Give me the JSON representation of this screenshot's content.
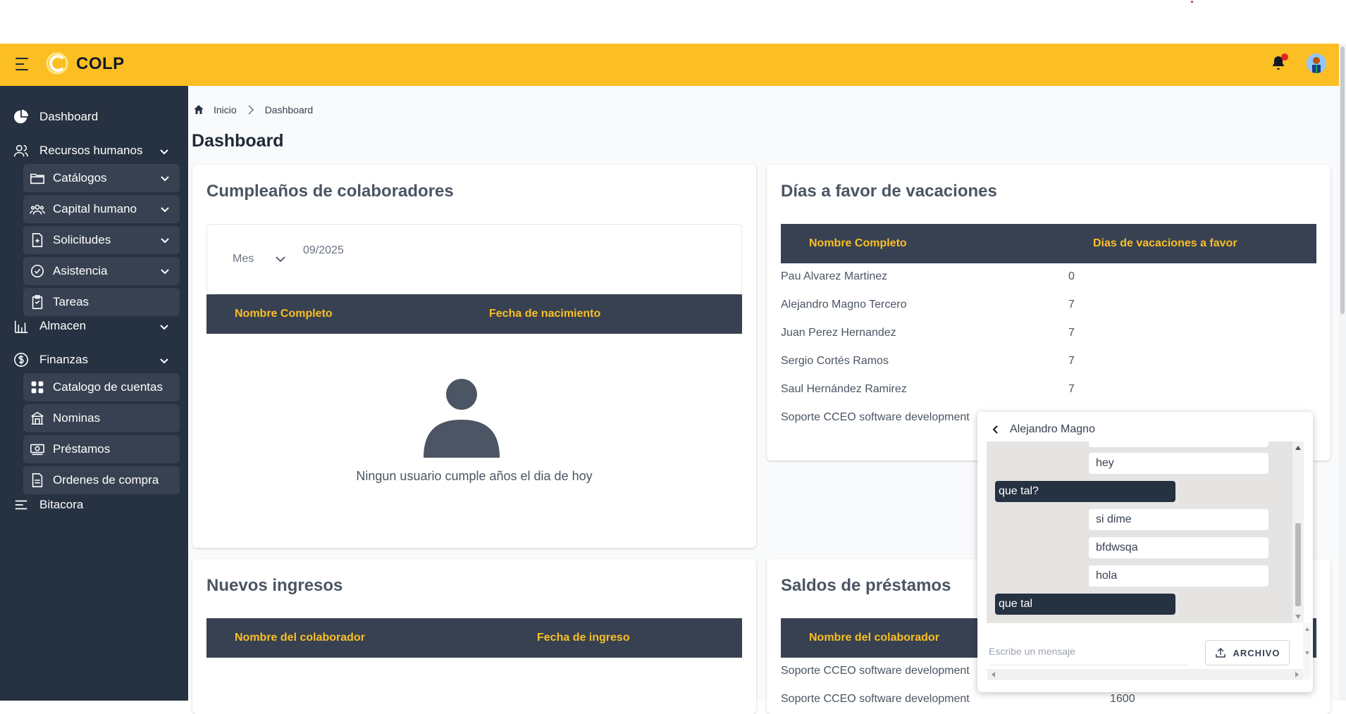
{
  "app": {
    "brand": "COLP"
  },
  "sidebar": {
    "items": [
      {
        "label": "Dashboard"
      },
      {
        "label": "Recursos humanos"
      },
      {
        "label": "Catálogos"
      },
      {
        "label": "Capital humano"
      },
      {
        "label": "Solicitudes"
      },
      {
        "label": "Asistencia"
      },
      {
        "label": "Tareas"
      },
      {
        "label": "Almacen"
      },
      {
        "label": "Finanzas"
      },
      {
        "label": "Catalogo de cuentas"
      },
      {
        "label": "Nominas"
      },
      {
        "label": "Préstamos"
      },
      {
        "label": "Ordenes de compra"
      },
      {
        "label": "Bitacora"
      }
    ]
  },
  "breadcrumb": {
    "home": "Inicio",
    "current": "Dashboard"
  },
  "page": {
    "title": "Dashboard"
  },
  "birthdays": {
    "title": "Cumpleaños de colaboradores",
    "filter_label": "Mes",
    "filter_value": "09/2025",
    "columns": [
      "Nombre Completo",
      "Fecha de nacimiento"
    ],
    "empty_message": "Ningun usuario cumple años el dia de hoy"
  },
  "vacations": {
    "title": "Días a favor de vacaciones",
    "columns": [
      "Nombre Completo",
      "Dias de vacaciones a favor"
    ],
    "rows": [
      {
        "name": "Pau Alvarez Martinez",
        "days": "0"
      },
      {
        "name": "Alejandro Magno Tercero",
        "days": "7"
      },
      {
        "name": "Juan Perez Hernandez",
        "days": "7"
      },
      {
        "name": "Sergio Cortés Ramos",
        "days": "7"
      },
      {
        "name": "Saul Hernández Ramirez",
        "days": "7"
      },
      {
        "name": "Soporte CCEO software development",
        "days": ""
      }
    ]
  },
  "new_hires": {
    "title": "Nuevos ingresos",
    "columns": [
      "Nombre del colaborador",
      "Fecha de ingreso"
    ]
  },
  "loans": {
    "title": "Saldos de préstamos",
    "columns": [
      "Nombre del colaborador"
    ],
    "rows": [
      {
        "name": "Soporte CCEO software development",
        "amount": ""
      },
      {
        "name": "Soporte CCEO software development",
        "amount": "1600"
      }
    ]
  },
  "chat": {
    "contact": "Alejandro Magno",
    "messages": [
      {
        "from": "them",
        "text": "hey"
      },
      {
        "from": "me",
        "text": "que tal?"
      },
      {
        "from": "them",
        "text": "si dime"
      },
      {
        "from": "them",
        "text": "bfdwsqa"
      },
      {
        "from": "them",
        "text": "hola"
      },
      {
        "from": "me",
        "text": "que tal"
      }
    ],
    "input_placeholder": "Escribe un mensaje",
    "file_button": "ARCHIVO"
  },
  "colors": {
    "accent": "#fbbf24",
    "sidebar": "#263141",
    "header_row": "#374151"
  },
  "icons": [
    "menu-icon",
    "logo-icon",
    "bell-icon",
    "avatar",
    "pie-chart-icon",
    "users-icon",
    "folder-icon",
    "people-group-icon",
    "file-plus-icon",
    "check-circle-icon",
    "clipboard-icon",
    "building-chart-icon",
    "dollar-icon",
    "grid-icon",
    "bank-icon",
    "money-icon",
    "document-icon",
    "list-icon",
    "home-icon",
    "chevron-right-icon",
    "chevron-down-icon",
    "chevron-left-icon",
    "upload-icon"
  ]
}
